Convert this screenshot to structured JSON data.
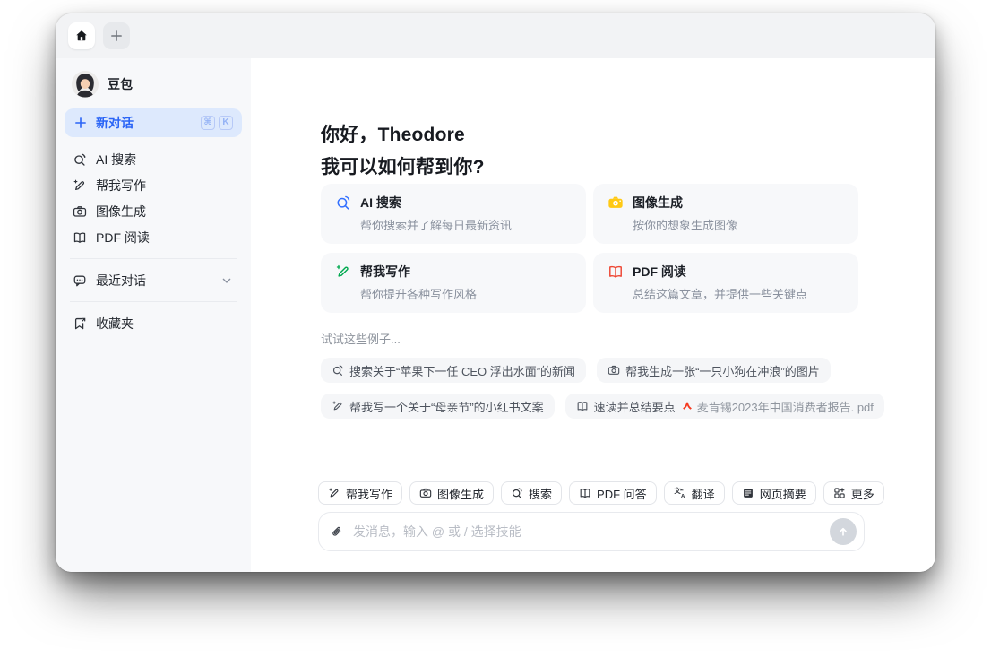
{
  "colors": {
    "brand_blue": "#2A64F6",
    "active_item_bg": "#DDE9FD",
    "search_blue": "#3370FF",
    "write_green": "#00A94F",
    "image_yellow": "#FFC914",
    "pdf_red": "#EE4633",
    "pdf_file_red": "#F5391F"
  },
  "tab_bar": {
    "tabs": [
      {
        "name": "home",
        "icon": "home-icon"
      },
      {
        "name": "new-tab",
        "icon": "plus-icon"
      }
    ]
  },
  "sidebar": {
    "profile": {
      "name": "豆包",
      "avatar": "doubao-avatar"
    },
    "new_chat": {
      "label": "新对话",
      "icon": "plus-icon",
      "shortcut_keys": [
        "⌘",
        "K"
      ]
    },
    "items": [
      {
        "label": "AI 搜索",
        "icon": "ai-search-icon"
      },
      {
        "label": "帮我写作",
        "icon": "write-pen-icon"
      },
      {
        "label": "图像生成",
        "icon": "camera-icon"
      },
      {
        "label": "PDF 阅读",
        "icon": "book-icon"
      }
    ],
    "recent": {
      "label": "最近对话",
      "icon": "chat-bubble-icon",
      "chevron": "chevron-down-icon"
    },
    "favorites": {
      "label": "收藏夹",
      "icon": "bookmark-icon"
    }
  },
  "main": {
    "greeting_line1": "你好，Theodore",
    "greeting_line2": "我可以如何帮到你?",
    "skill_cards": [
      {
        "title": "AI 搜索",
        "desc": "帮你搜索并了解每日最新资讯",
        "icon": "ai-search-icon",
        "accent": "#3370FF"
      },
      {
        "title": "图像生成",
        "desc": "按你的想象生成图像",
        "icon": "camera-icon",
        "accent": "#FFC914"
      },
      {
        "title": "帮我写作",
        "desc": "帮你提升各种写作风格",
        "icon": "write-pen-icon",
        "accent": "#00A94F"
      },
      {
        "title": "PDF 阅读",
        "desc": "总结这篇文章，并提供一些关键点",
        "icon": "book-icon",
        "accent": "#EE4633"
      }
    ],
    "examples_label": "试试这些例子...",
    "examples": [
      {
        "text": "搜索关于“苹果下一任 CEO 浮出水面”的新闻",
        "icon": "ai-search-icon"
      },
      {
        "text": "帮我生成一张“一只小狗在冲浪”的图片",
        "icon": "camera-icon"
      },
      {
        "text": "帮我写一个关于“母亲节”的小红书文案",
        "icon": "write-pen-icon"
      },
      {
        "text": "速读并总结要点",
        "icon": "book-icon",
        "file_icon": "pdf-file-icon",
        "file": "麦肯锡2023年中国消费者报告. pdf"
      }
    ]
  },
  "composer": {
    "skill_chips": [
      {
        "label": "帮我写作",
        "icon": "write-pen-icon"
      },
      {
        "label": "图像生成",
        "icon": "camera-icon"
      },
      {
        "label": "搜索",
        "icon": "ai-search-icon"
      },
      {
        "label": "PDF 问答",
        "icon": "book-icon"
      },
      {
        "label": "翻译",
        "icon": "translate-icon"
      },
      {
        "label": "网页摘要",
        "icon": "webpage-icon"
      },
      {
        "label": "更多",
        "icon": "more-grid-icon"
      }
    ],
    "input": {
      "placeholder": "发消息，输入 @ 或 / 选择技能",
      "attach_icon": "paperclip-icon",
      "send_icon": "arrow-up-icon"
    }
  }
}
